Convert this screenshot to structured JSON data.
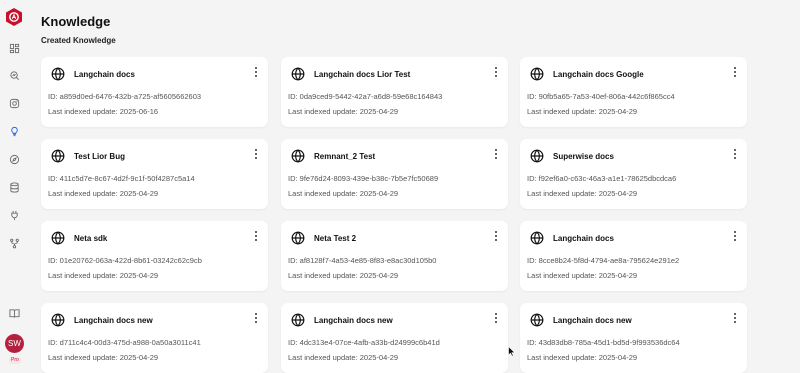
{
  "page": {
    "title": "Knowledge",
    "section": "Created Knowledge"
  },
  "sidebar": {
    "icons": [
      "dashboard-icon",
      "search-chart-icon",
      "instagram-icon",
      "lightbulb-icon",
      "compass-icon",
      "database-icon",
      "plug-icon",
      "branch-icon",
      "book-icon"
    ],
    "active": "lightbulb-icon",
    "user_initials": "SW",
    "plan_badge": "Pro"
  },
  "cards": [
    {
      "name": "Langchain docs",
      "id": "ID: a859d0ed-6476-432b-a725-af5605662603",
      "updated": "Last indexed update: 2025-06-16"
    },
    {
      "name": "Langchain docs Lior Test",
      "id": "ID: 0da9ced9-5442-42a7-a6d8-59e68c164843",
      "updated": "Last indexed update: 2025-04-29"
    },
    {
      "name": "Langchain docs Google",
      "id": "ID: 90fb5a65-7a53-40ef-806a-442c6f865cc4",
      "updated": "Last indexed update: 2025-04-29"
    },
    {
      "name": "Test Lior Bug",
      "id": "ID: 411c5d7e-8c67-4d2f-9c1f-50f4287c5a14",
      "updated": "Last indexed update: 2025-04-29"
    },
    {
      "name": "Remnant_2 Test",
      "id": "ID: 9fe76d24-8093-439e-b38c-7b5e7fc50689",
      "updated": "Last indexed update: 2025-04-29"
    },
    {
      "name": "Superwise docs",
      "id": "ID: f92ef6a0-c63c-46a3-a1e1-78625dbcdca6",
      "updated": "Last indexed update: 2025-04-29"
    },
    {
      "name": "Neta sdk",
      "id": "ID: 01e20762-063a-422d-8b61-03242c62c9cb",
      "updated": "Last indexed update: 2025-04-29"
    },
    {
      "name": "Neta Test 2",
      "id": "ID: af8128f7-4a53-4e85-8f83-e8ac30d105b0",
      "updated": "Last indexed update: 2025-04-29"
    },
    {
      "name": "Langchain docs",
      "id": "ID: 8cce8b24-5f8d-4794-ae8a-795624e291e2",
      "updated": "Last indexed update: 2025-04-29"
    },
    {
      "name": "Langchain docs new",
      "id": "ID: d711c4c4-00d3-475d-a988-0a50a3011c41",
      "updated": "Last indexed update: 2025-04-29"
    },
    {
      "name": "Langchain docs new",
      "id": "ID: 4dc313e4-07ce-4afb-a33b-d24999c6b41d",
      "updated": "Last indexed update: 2025-04-29"
    },
    {
      "name": "Langchain docs new",
      "id": "ID: 43d83db8-785a-45d1-bd5d-9f993536dc64",
      "updated": "Last indexed update: 2025-04-29"
    }
  ],
  "colors": {
    "brand": "#c8102e",
    "active_nav": "#2563eb",
    "avatar": "#b3213f",
    "background": "#f4f4f5"
  }
}
